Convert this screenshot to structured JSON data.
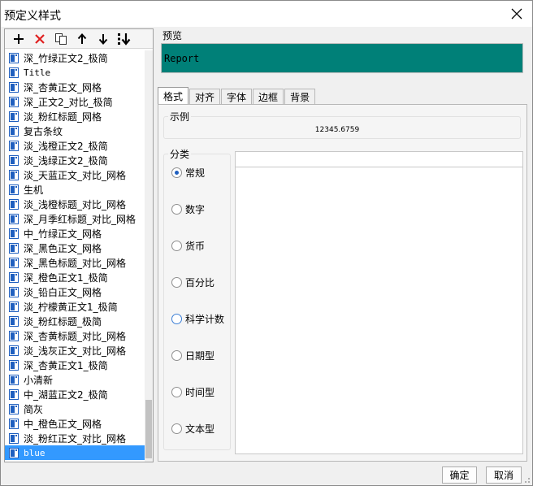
{
  "window": {
    "title": "预定义样式"
  },
  "toolbar": {
    "buttons": [
      {
        "name": "add-button",
        "icon": "plus-icon"
      },
      {
        "name": "delete-button",
        "icon": "red-x-icon"
      },
      {
        "name": "copy-button",
        "icon": "copy-icon"
      },
      {
        "name": "move-up-button",
        "icon": "arrow-up-icon"
      },
      {
        "name": "move-down-button",
        "icon": "arrow-down-icon"
      },
      {
        "name": "sort-button",
        "icon": "sort-down-icon"
      }
    ]
  },
  "style_list": [
    {
      "label": "深_竹绿正文2_极简"
    },
    {
      "label": "Title",
      "mono": true
    },
    {
      "label": "深_杏黄正文_网格"
    },
    {
      "label": "深_正文2_对比_极简"
    },
    {
      "label": "淡_粉红标题_网格"
    },
    {
      "label": "复古条纹"
    },
    {
      "label": "淡_浅橙正文2_极简"
    },
    {
      "label": "淡_浅绿正文2_极简"
    },
    {
      "label": "淡_天蓝正文_对比_网格"
    },
    {
      "label": "生机"
    },
    {
      "label": "淡_浅橙标题_对比_网格"
    },
    {
      "label": "深_月季红标题_对比_网格"
    },
    {
      "label": "中_竹绿正文_网格"
    },
    {
      "label": "深_黑色正文_网格"
    },
    {
      "label": "深_黑色标题_对比_网格"
    },
    {
      "label": "深_橙色正文1_极简"
    },
    {
      "label": "淡_铅白正文_网格"
    },
    {
      "label": "淡_柠檬黄正文1_极简"
    },
    {
      "label": "淡_粉红标题_极简"
    },
    {
      "label": "深_杏黄标题_对比_网格"
    },
    {
      "label": "淡_浅灰正文_对比_网格"
    },
    {
      "label": "深_杏黄正文1_极简"
    },
    {
      "label": "小清新"
    },
    {
      "label": "中_湖蓝正文2_极简"
    },
    {
      "label": "简灰"
    },
    {
      "label": "中_橙色正文_网格"
    },
    {
      "label": "淡_粉红正文_对比_网格"
    },
    {
      "label": "blue",
      "mono": true,
      "selected": true
    }
  ],
  "preview": {
    "label": "预览",
    "text": "Report",
    "background": "#008078"
  },
  "tabs": [
    {
      "label": "格式",
      "active": true
    },
    {
      "label": "对齐"
    },
    {
      "label": "字体"
    },
    {
      "label": "边框"
    },
    {
      "label": "背景"
    }
  ],
  "format": {
    "example_label": "示例",
    "example_value": "12345.6759",
    "category_label": "分类",
    "categories": [
      {
        "label": "常规",
        "checked": true
      },
      {
        "label": "数字"
      },
      {
        "label": "货币"
      },
      {
        "label": "百分比"
      },
      {
        "label": "科学计数",
        "hover": true
      },
      {
        "label": "日期型"
      },
      {
        "label": "时间型"
      },
      {
        "label": "文本型"
      }
    ]
  },
  "buttons": {
    "ok": "确定",
    "cancel": "取消"
  },
  "colors": {
    "selection": "#3399ff",
    "delete_red": "#e02020",
    "icon_blue": "#1f5fbf"
  }
}
